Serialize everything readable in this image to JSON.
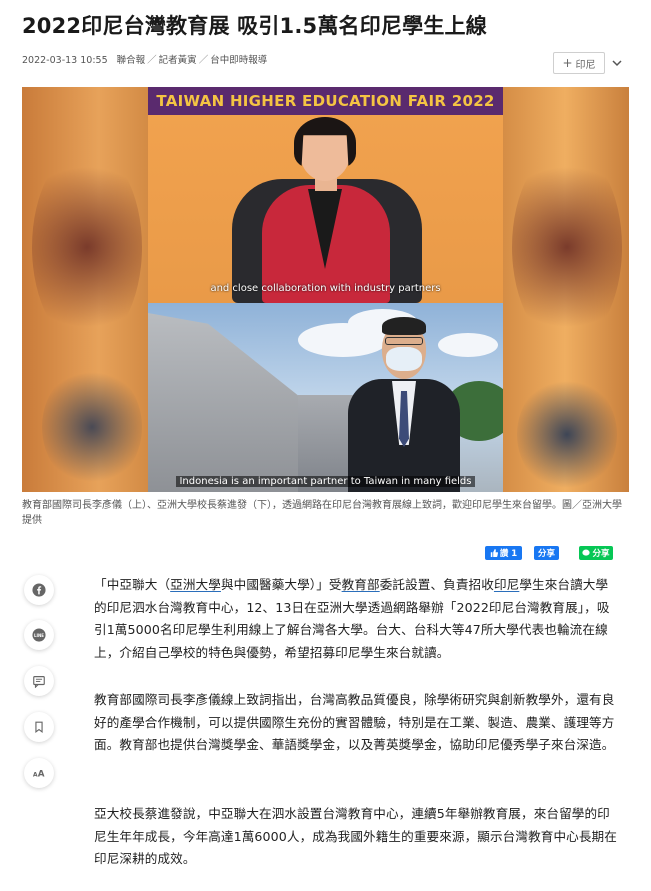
{
  "article": {
    "headline": "2022印尼台灣教育展 吸引1.5萬名印尼學生上線",
    "meta": {
      "datetime": "2022-03-13 10:55",
      "source": "聯合報",
      "reporter": "記者黃寅",
      "reporter_sep": "／",
      "desk": "台中即時報導",
      "byline_prefix": "／"
    },
    "tag_button_label": "印尼",
    "photo": {
      "banner_text": "TAIWAN HIGHER EDUCATION FAIR 2022",
      "subtitle_top": "and close collaboration with industry partners",
      "subtitle_bottom": "Indonesia is an important partner to Taiwan in many fields",
      "caption": "教育部國際司長李彥儀（上）、亞洲大學校長蔡進發（下），透過網路在印尼台灣教育展線上致詞，歡迎印尼學生來台留學。圖／亞洲大學提供"
    },
    "paragraphs": [
      {
        "p0": "「中亞聯大（",
        "l0": "亞洲大學",
        "p1": "與中國醫藥大學）」受",
        "l1": "教育部",
        "p2": "委託設置、負責招收",
        "l2": "印尼",
        "p3": "學生來台讀大學的印尼泗水台灣教育中心，12、13日在亞洲大學透過網路舉辦「2022印尼台灣教育展」，吸引1萬5000名印尼學生利用線上了解台灣各大學。台大、台科大等47所大學代表也輪流在線上，介紹自己學校的特色與優勢，希望招募印尼學生來台就讀。"
      },
      {
        "text": "教育部國際司長李彥儀線上致詞指出，台灣高教品質優良，除學術研究與創新教學外，還有良好的產學合作機制，可以提供國際生充份的實習體驗，特別是在工業、製造、農業、護理等方面。教育部也提供台灣獎學金、華語獎學金，以及菁英獎學金，協助印尼優秀學子來台深造。"
      },
      {
        "text": "亞大校長蔡進發說，中亞聯大在泗水設置台灣教育中心，連續5年舉辦教育展，來台留學的印尼生年年成長，今年高達1萬6000人，成為我國外籍生的重要來源，顯示台灣教育中心長期在印尼深耕的成效。"
      }
    ]
  },
  "share": {
    "fb_like_label": "讚 1",
    "fb_share_label": "分享",
    "line_share_label": "分享"
  },
  "sidebar_actions": [
    {
      "icon": "facebook-icon"
    },
    {
      "icon": "line-icon"
    },
    {
      "icon": "comment-icon"
    },
    {
      "icon": "bookmark-icon"
    },
    {
      "icon": "font-size-icon",
      "label": "AA"
    }
  ],
  "colors": {
    "link_underline": "#2a6ebb",
    "fb_blue": "#1877f2",
    "line_green": "#06c755",
    "banner_purple": "#5a2a6e",
    "banner_text": "#f4c443"
  }
}
